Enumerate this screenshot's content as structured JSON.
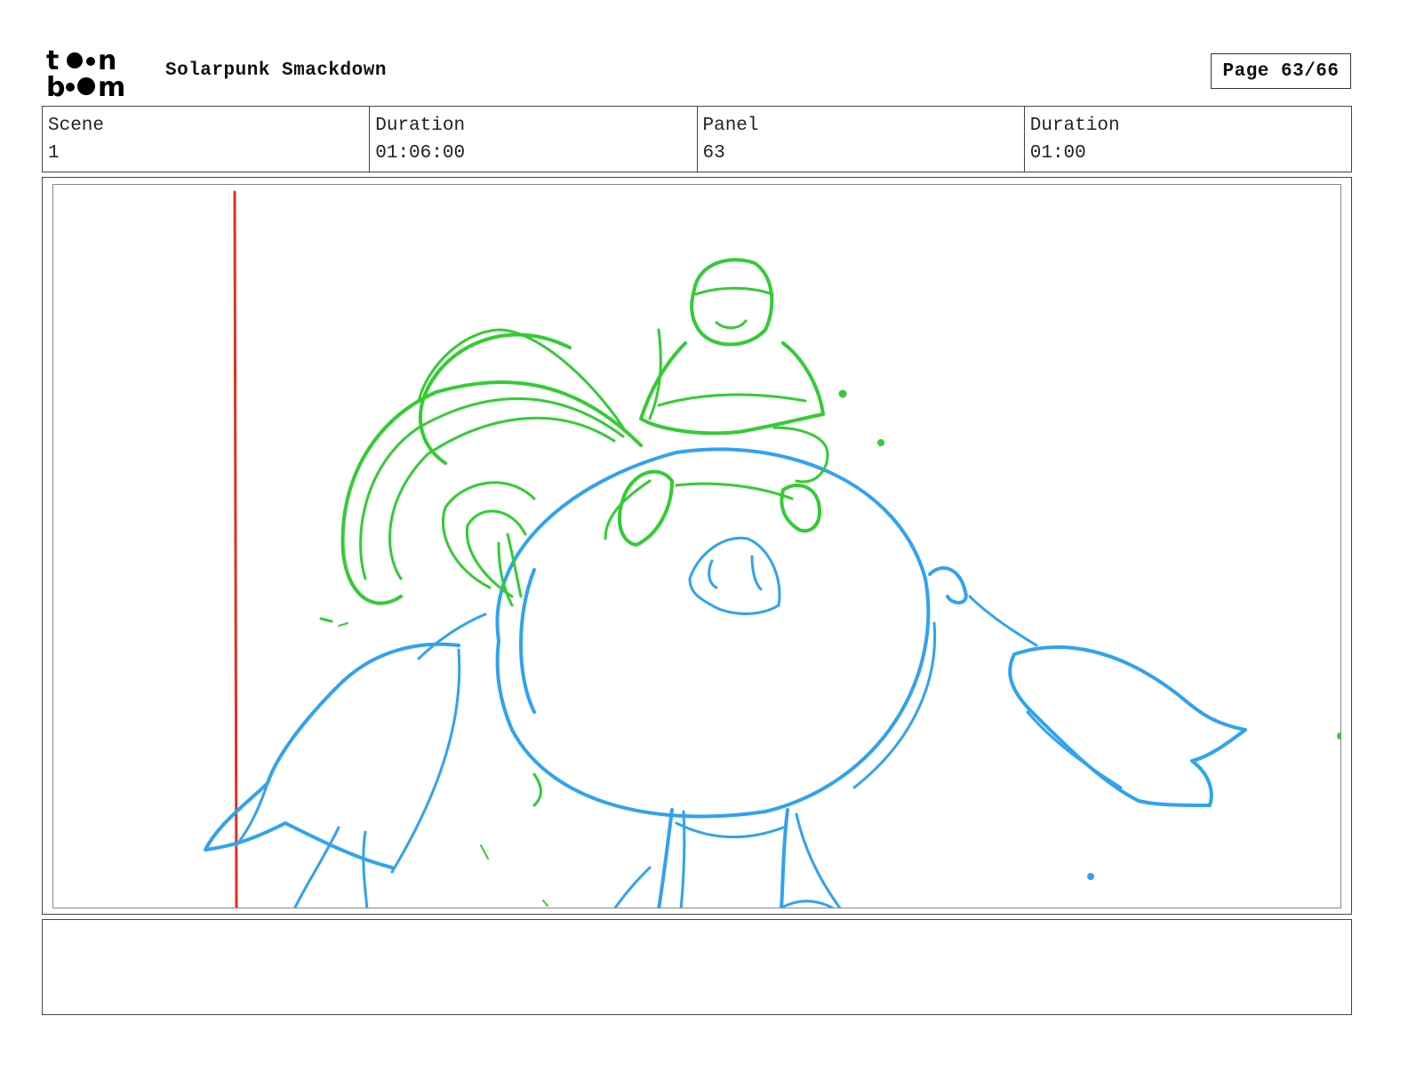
{
  "header": {
    "logo_text_top": "toon",
    "logo_text_bottom": "boom",
    "project_title": "Solarpunk Smackdown",
    "page_label": "Page 63/66"
  },
  "info": [
    {
      "label": "Scene",
      "value": "1"
    },
    {
      "label": "Duration",
      "value": "01:06:00"
    },
    {
      "label": "Panel",
      "value": "63"
    },
    {
      "label": "Duration",
      "value": "01:00"
    }
  ],
  "panel": {
    "sketch_colors": {
      "rider": "#33cc33",
      "creature": "#2fa3f0",
      "guide_line": "#e0301e"
    }
  },
  "notes": {
    "text": ""
  }
}
